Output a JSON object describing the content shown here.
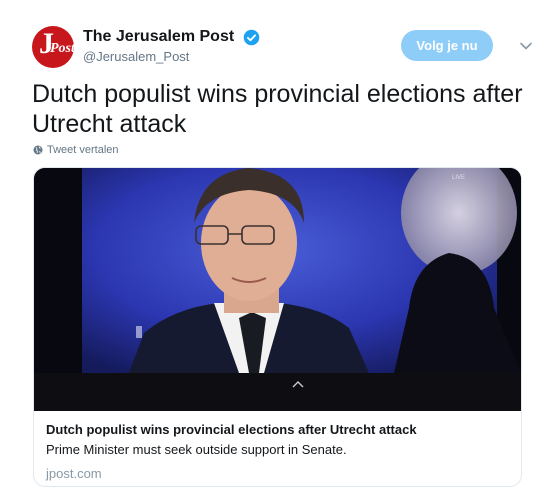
{
  "account": {
    "display_name": "The Jerusalem Post",
    "handle": "@Jerusalem_Post",
    "avatar_letters": {
      "j": "J",
      "p": "Post"
    },
    "verified": true
  },
  "follow_button": {
    "label": "Volg je nu"
  },
  "tweet": {
    "text": "Dutch populist wins provincial elections after Utrecht attack"
  },
  "translate": {
    "label": "Tweet vertalen"
  },
  "card": {
    "image_overlay": {
      "live_label": "LIVE"
    },
    "title": "Dutch populist wins provincial elections after Utrecht attack",
    "description": "Prime Minister must seek outside support in Senate.",
    "domain": "jpost.com"
  },
  "colors": {
    "brand_red": "#c8161d",
    "verified_blue": "#1da1f2",
    "follow_button_bg": "#8ecdf7",
    "secondary_text": "#657786"
  },
  "icons": {
    "verified": "verified-badge-icon",
    "menu": "chevron-down-icon",
    "translate": "globe-icon"
  }
}
